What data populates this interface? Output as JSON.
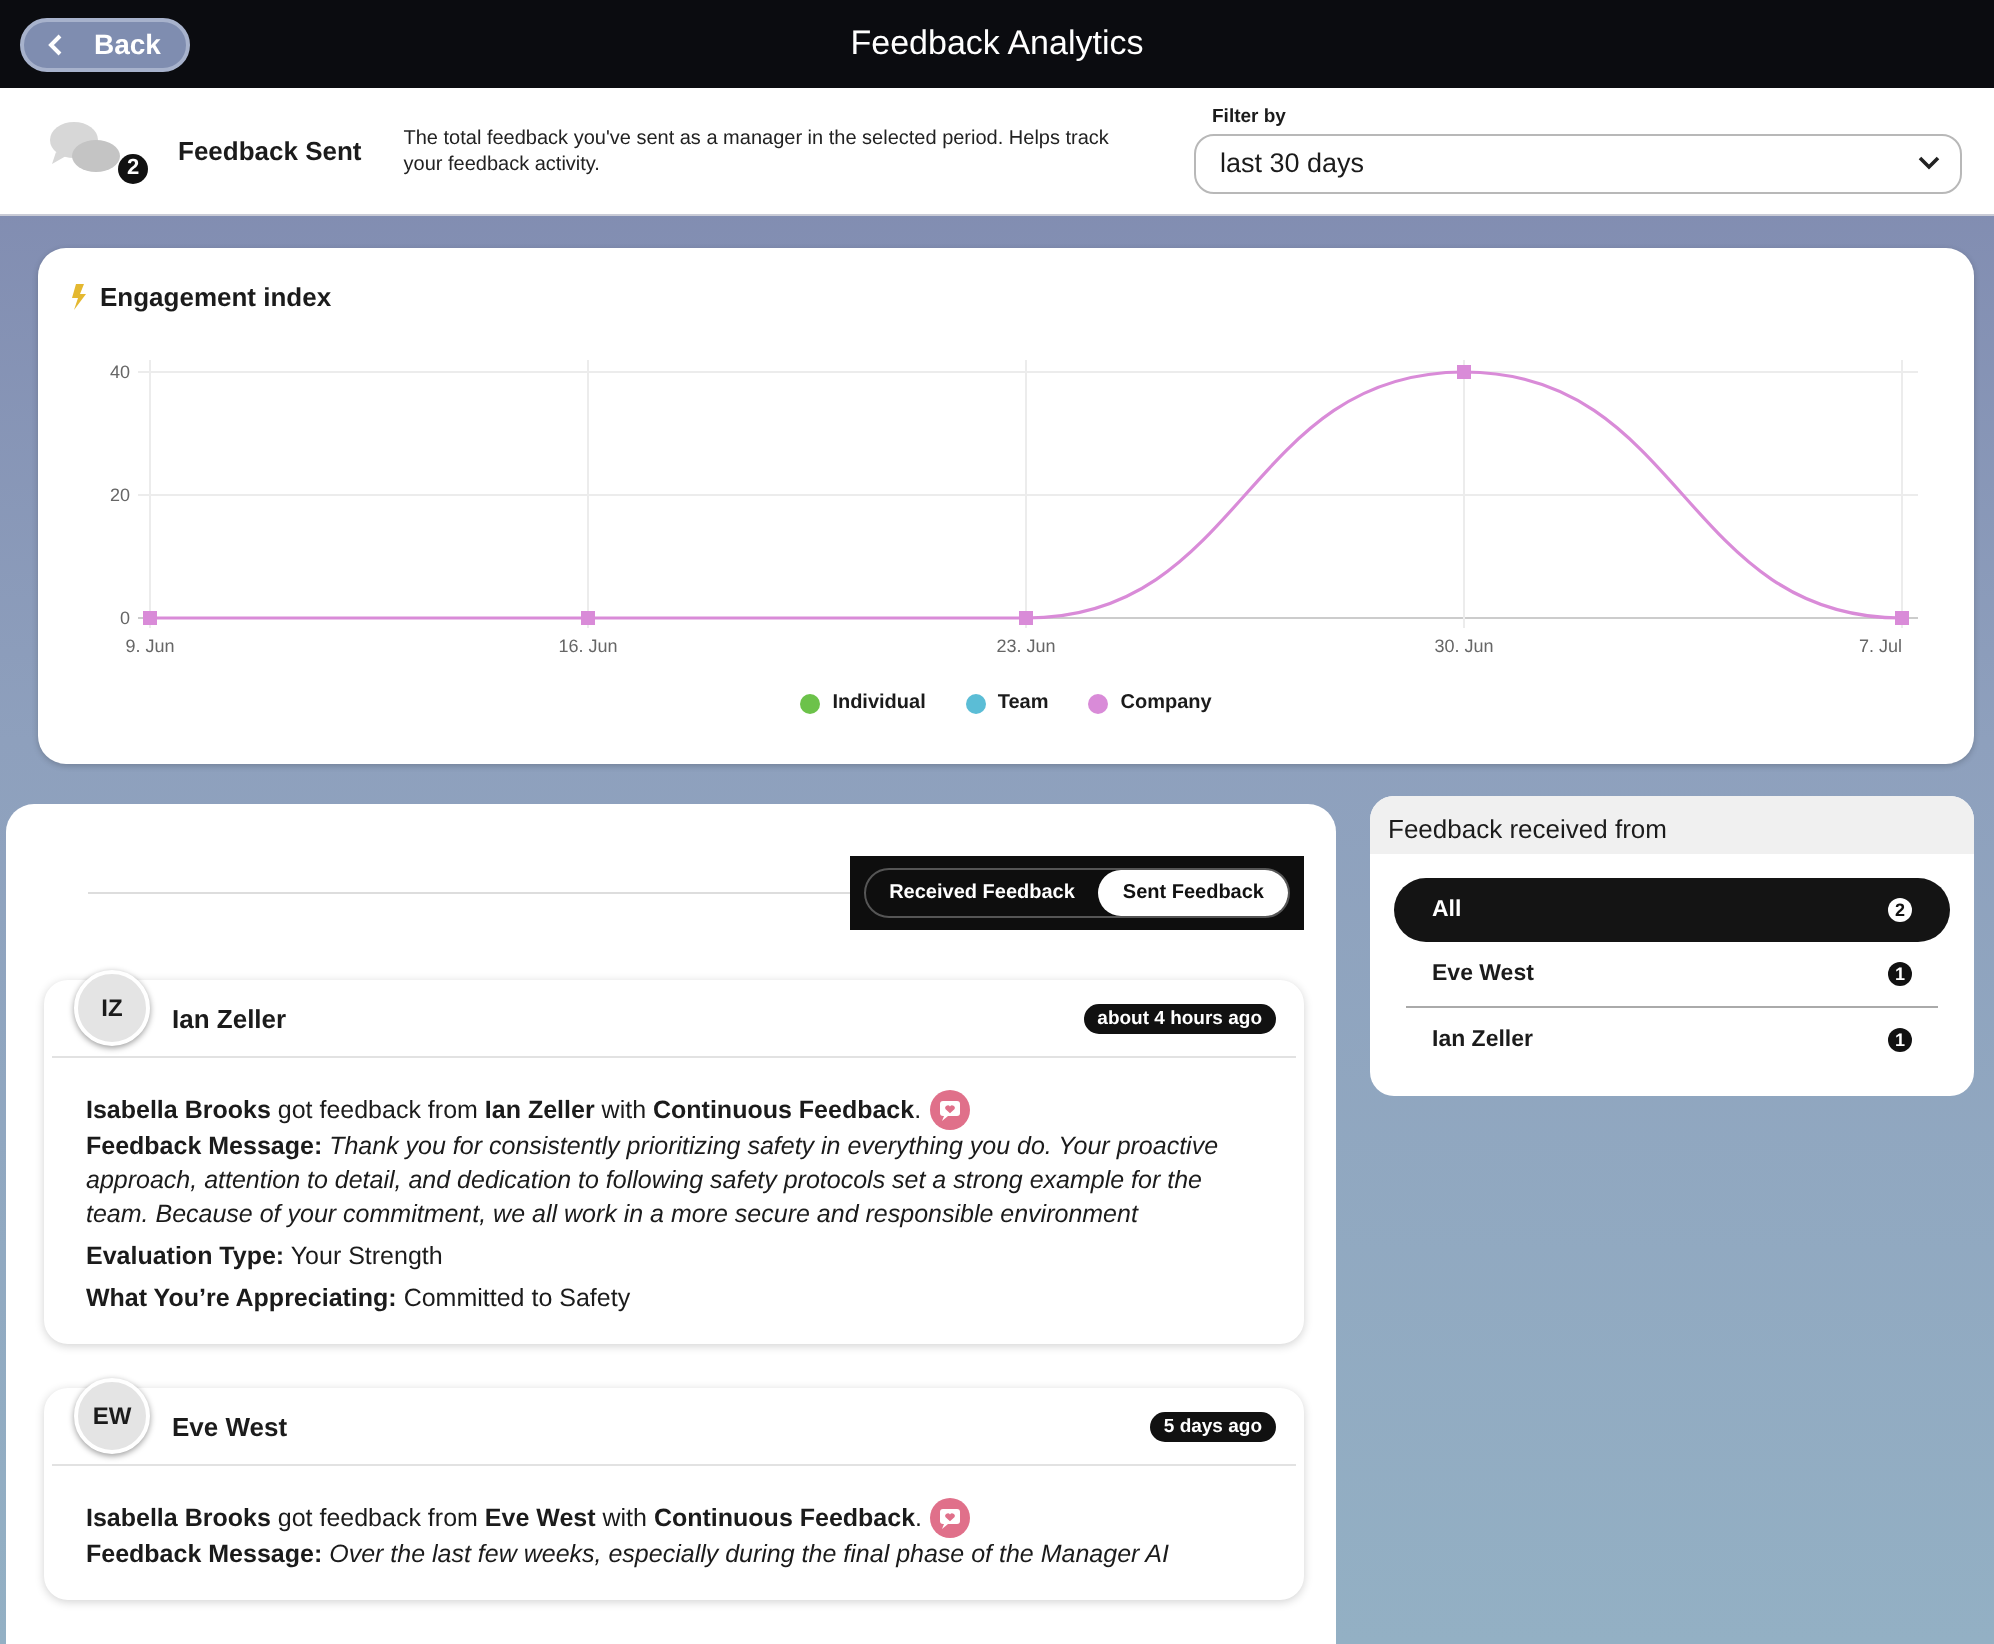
{
  "top_bar": {
    "back_label": "Back",
    "title": "Feedback Analytics"
  },
  "summary": {
    "count": "2",
    "title": "Feedback Sent",
    "description": "The total feedback you've sent as a manager in the selected period. Helps track your feedback activity.",
    "filter_label": "Filter by",
    "filter_value": "last 30 days"
  },
  "engagement": {
    "title": "Engagement index",
    "chart_data": {
      "type": "line",
      "categories": [
        "9. Jun",
        "16. Jun",
        "23. Jun",
        "30. Jun",
        "7. Jul"
      ],
      "ylim": [
        0,
        40
      ],
      "grid": true,
      "yticks": [
        0,
        20,
        40
      ],
      "series": [
        {
          "name": "Individual",
          "color": "#6cc24a",
          "values": [
            null,
            null,
            null,
            null,
            null
          ]
        },
        {
          "name": "Team",
          "color": "#5bbdd6",
          "values": [
            null,
            null,
            null,
            null,
            null
          ]
        },
        {
          "name": "Company",
          "color": "#d98bd8",
          "marker": true,
          "values": [
            0,
            0,
            0,
            40,
            0
          ]
        }
      ]
    }
  },
  "toggle": [
    {
      "label": "Received Feedback",
      "selected": false
    },
    {
      "label": "Sent Feedback",
      "selected": true
    }
  ],
  "feedback": [
    {
      "initials": "IZ",
      "name": "Ian Zeller",
      "time": "about 4 hours ago",
      "summary": "**Isabella Brooks** got feedback from **Ian Zeller** with **Continuous Feedback**.",
      "details": [
        {
          "label": "Feedback Message:",
          "value": "Thank you for consistently prioritizing safety in everything you do. Your proactive approach, attention to detail, and dedication to following safety protocols set a strong example for the team. Because of your commitment, we all work in a more secure and responsible environment",
          "kind": "italic"
        },
        {
          "label": "Evaluation Type:",
          "value": "Your Strength",
          "kind": "plain"
        },
        {
          "label": "What You’re Appreciating:",
          "value": "Committed to Safety",
          "kind": "plain"
        }
      ]
    },
    {
      "initials": "EW",
      "name": "Eve West",
      "time": "5 days ago",
      "summary": "**Isabella Brooks** got feedback from **Eve West** with **Continuous Feedback**.",
      "details": [
        {
          "label": "Feedback Message:",
          "value": "Over the last few weeks, especially during the final phase of the Manager AI",
          "kind": "italic"
        }
      ]
    }
  ],
  "sources": {
    "title": "Feedback received from",
    "items": [
      {
        "name": "All",
        "count": "2",
        "selected": true
      },
      {
        "name": "Eve West",
        "count": "1",
        "selected": false
      },
      {
        "name": "Ian Zeller",
        "count": "1",
        "selected": false
      }
    ]
  }
}
